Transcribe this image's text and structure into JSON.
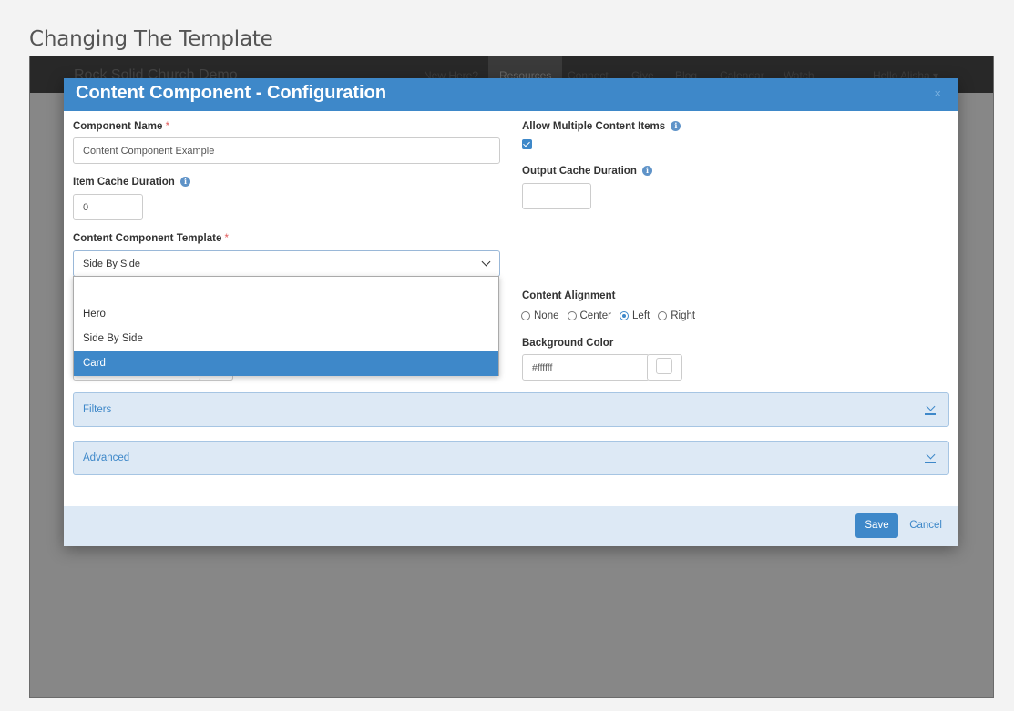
{
  "page": {
    "heading": "Changing The Template"
  },
  "navbar": {
    "brand": "Rock Solid Church Demo",
    "links": [
      "New Here?",
      "Resources",
      "Connect",
      "Give",
      "Blog",
      "Calendar",
      "Watch"
    ],
    "active_link": "Resources",
    "user": "Hello Alisha ▾"
  },
  "modal": {
    "title": "Content Component - Configuration",
    "close_label": "×",
    "component_name": {
      "label": "Component Name",
      "required_mark": "*",
      "value": "Content Component Example"
    },
    "allow_multiple": {
      "label": "Allow Multiple Content Items",
      "info_icon": "i",
      "checked": true
    },
    "item_cache": {
      "label": "Item Cache Duration",
      "info_icon": "i",
      "value": "0"
    },
    "output_cache": {
      "label": "Output Cache Duration",
      "info_icon": "i",
      "value": ""
    },
    "template": {
      "label": "Content Component Template",
      "required_mark": "*",
      "selected": "Side By Side"
    },
    "template_options": [
      "",
      "Hero",
      "Side By Side",
      "Card"
    ],
    "highlighted_option": "Card",
    "content_alignment": {
      "label": "Content Alignment",
      "options": [
        "None",
        "Center",
        "Left",
        "Right"
      ],
      "selected": "Left"
    },
    "background_color": {
      "label": "Background Color",
      "value": "#ffffff"
    },
    "panels": {
      "filters": "Filters",
      "advanced": "Advanced"
    },
    "footer": {
      "save_label": "Save",
      "cancel_label": "Cancel"
    }
  },
  "colors": {
    "accent": "#3e88c9",
    "panel_bg": "#dde9f5",
    "required": "#e25a5a"
  }
}
